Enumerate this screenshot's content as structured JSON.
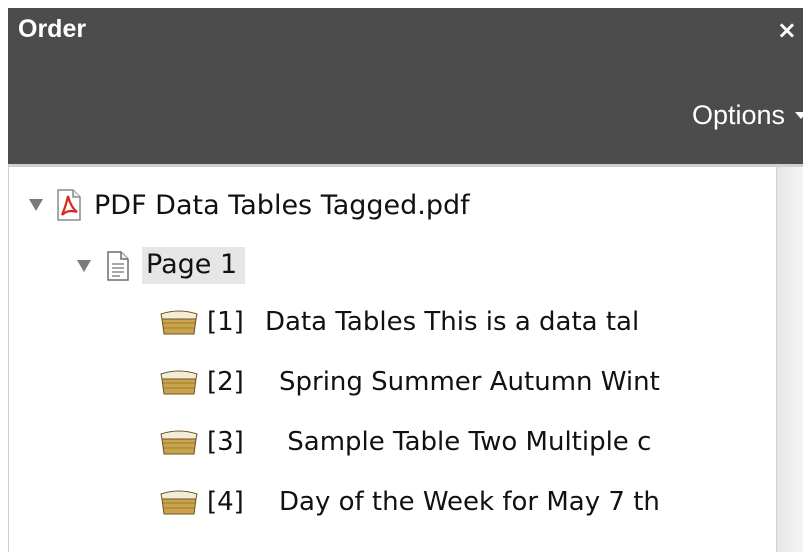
{
  "panel": {
    "title": "Order",
    "close_icon": "×",
    "options_label": "Options"
  },
  "tree": {
    "document": {
      "label": "PDF Data Tables Tagged.pdf",
      "icon": "pdf-file-icon"
    },
    "page": {
      "label": "Page 1",
      "icon": "page-icon"
    },
    "items": [
      {
        "number": "[1]",
        "text": "Data Tables  This is a data tal",
        "icon": "content-box-icon"
      },
      {
        "number": "[2]",
        "text": "Spring Summer Autumn Wint",
        "icon": "content-box-icon"
      },
      {
        "number": "[3]",
        "text": " Sample Table Two Multiple c",
        "icon": "content-box-icon"
      },
      {
        "number": "[4]",
        "text": "Day of the Week for May 7 th",
        "icon": "content-box-icon"
      }
    ]
  }
}
